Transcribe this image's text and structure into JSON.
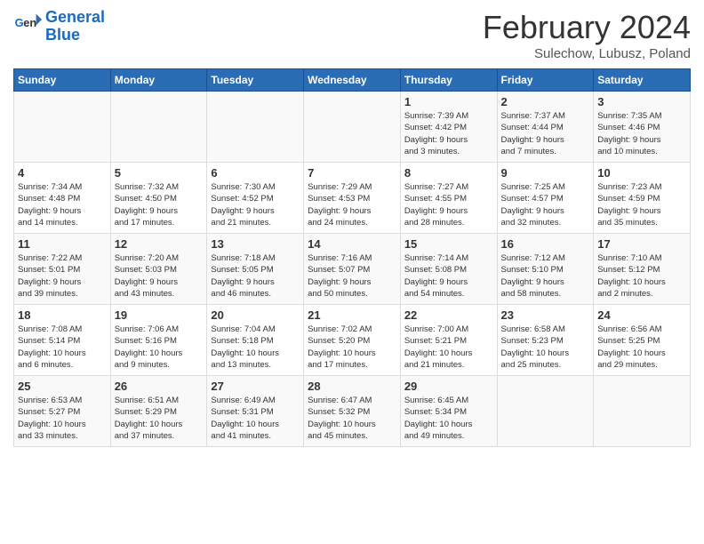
{
  "logo": {
    "line1": "General",
    "line2": "Blue"
  },
  "title": "February 2024",
  "subtitle": "Sulechow, Lubusz, Poland",
  "weekdays": [
    "Sunday",
    "Monday",
    "Tuesday",
    "Wednesday",
    "Thursday",
    "Friday",
    "Saturday"
  ],
  "weeks": [
    [
      {
        "day": "",
        "info": ""
      },
      {
        "day": "",
        "info": ""
      },
      {
        "day": "",
        "info": ""
      },
      {
        "day": "",
        "info": ""
      },
      {
        "day": "1",
        "info": "Sunrise: 7:39 AM\nSunset: 4:42 PM\nDaylight: 9 hours\nand 3 minutes."
      },
      {
        "day": "2",
        "info": "Sunrise: 7:37 AM\nSunset: 4:44 PM\nDaylight: 9 hours\nand 7 minutes."
      },
      {
        "day": "3",
        "info": "Sunrise: 7:35 AM\nSunset: 4:46 PM\nDaylight: 9 hours\nand 10 minutes."
      }
    ],
    [
      {
        "day": "4",
        "info": "Sunrise: 7:34 AM\nSunset: 4:48 PM\nDaylight: 9 hours\nand 14 minutes."
      },
      {
        "day": "5",
        "info": "Sunrise: 7:32 AM\nSunset: 4:50 PM\nDaylight: 9 hours\nand 17 minutes."
      },
      {
        "day": "6",
        "info": "Sunrise: 7:30 AM\nSunset: 4:52 PM\nDaylight: 9 hours\nand 21 minutes."
      },
      {
        "day": "7",
        "info": "Sunrise: 7:29 AM\nSunset: 4:53 PM\nDaylight: 9 hours\nand 24 minutes."
      },
      {
        "day": "8",
        "info": "Sunrise: 7:27 AM\nSunset: 4:55 PM\nDaylight: 9 hours\nand 28 minutes."
      },
      {
        "day": "9",
        "info": "Sunrise: 7:25 AM\nSunset: 4:57 PM\nDaylight: 9 hours\nand 32 minutes."
      },
      {
        "day": "10",
        "info": "Sunrise: 7:23 AM\nSunset: 4:59 PM\nDaylight: 9 hours\nand 35 minutes."
      }
    ],
    [
      {
        "day": "11",
        "info": "Sunrise: 7:22 AM\nSunset: 5:01 PM\nDaylight: 9 hours\nand 39 minutes."
      },
      {
        "day": "12",
        "info": "Sunrise: 7:20 AM\nSunset: 5:03 PM\nDaylight: 9 hours\nand 43 minutes."
      },
      {
        "day": "13",
        "info": "Sunrise: 7:18 AM\nSunset: 5:05 PM\nDaylight: 9 hours\nand 46 minutes."
      },
      {
        "day": "14",
        "info": "Sunrise: 7:16 AM\nSunset: 5:07 PM\nDaylight: 9 hours\nand 50 minutes."
      },
      {
        "day": "15",
        "info": "Sunrise: 7:14 AM\nSunset: 5:08 PM\nDaylight: 9 hours\nand 54 minutes."
      },
      {
        "day": "16",
        "info": "Sunrise: 7:12 AM\nSunset: 5:10 PM\nDaylight: 9 hours\nand 58 minutes."
      },
      {
        "day": "17",
        "info": "Sunrise: 7:10 AM\nSunset: 5:12 PM\nDaylight: 10 hours\nand 2 minutes."
      }
    ],
    [
      {
        "day": "18",
        "info": "Sunrise: 7:08 AM\nSunset: 5:14 PM\nDaylight: 10 hours\nand 6 minutes."
      },
      {
        "day": "19",
        "info": "Sunrise: 7:06 AM\nSunset: 5:16 PM\nDaylight: 10 hours\nand 9 minutes."
      },
      {
        "day": "20",
        "info": "Sunrise: 7:04 AM\nSunset: 5:18 PM\nDaylight: 10 hours\nand 13 minutes."
      },
      {
        "day": "21",
        "info": "Sunrise: 7:02 AM\nSunset: 5:20 PM\nDaylight: 10 hours\nand 17 minutes."
      },
      {
        "day": "22",
        "info": "Sunrise: 7:00 AM\nSunset: 5:21 PM\nDaylight: 10 hours\nand 21 minutes."
      },
      {
        "day": "23",
        "info": "Sunrise: 6:58 AM\nSunset: 5:23 PM\nDaylight: 10 hours\nand 25 minutes."
      },
      {
        "day": "24",
        "info": "Sunrise: 6:56 AM\nSunset: 5:25 PM\nDaylight: 10 hours\nand 29 minutes."
      }
    ],
    [
      {
        "day": "25",
        "info": "Sunrise: 6:53 AM\nSunset: 5:27 PM\nDaylight: 10 hours\nand 33 minutes."
      },
      {
        "day": "26",
        "info": "Sunrise: 6:51 AM\nSunset: 5:29 PM\nDaylight: 10 hours\nand 37 minutes."
      },
      {
        "day": "27",
        "info": "Sunrise: 6:49 AM\nSunset: 5:31 PM\nDaylight: 10 hours\nand 41 minutes."
      },
      {
        "day": "28",
        "info": "Sunrise: 6:47 AM\nSunset: 5:32 PM\nDaylight: 10 hours\nand 45 minutes."
      },
      {
        "day": "29",
        "info": "Sunrise: 6:45 AM\nSunset: 5:34 PM\nDaylight: 10 hours\nand 49 minutes."
      },
      {
        "day": "",
        "info": ""
      },
      {
        "day": "",
        "info": ""
      }
    ]
  ]
}
